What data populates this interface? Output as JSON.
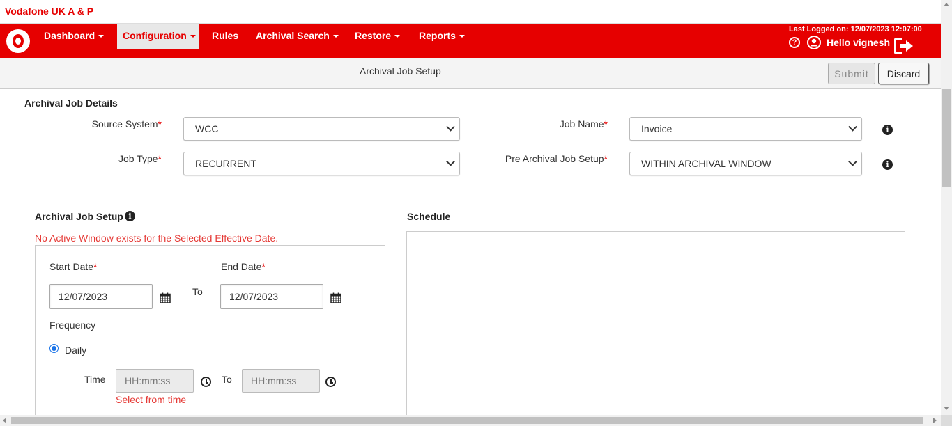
{
  "app": {
    "title": "Vodafone UK A & P"
  },
  "nav": {
    "items": [
      {
        "label": "Dashboard",
        "dropdown": true
      },
      {
        "label": "Configuration",
        "dropdown": true,
        "active": true
      },
      {
        "label": "Rules",
        "dropdown": false
      },
      {
        "label": "Archival Search",
        "dropdown": true
      },
      {
        "label": "Restore",
        "dropdown": true
      },
      {
        "label": "Reports",
        "dropdown": true
      }
    ],
    "last_logged": "Last Logged on: 12/07/2023 12:07:00",
    "greeting": "Hello vignesh",
    "brand_color": "#e60000"
  },
  "subheader": {
    "title": "Archival Job Setup",
    "submit_label": "Submit",
    "discard_label": "Discard"
  },
  "job_details": {
    "heading": "Archival Job Details",
    "source_system": {
      "label": "Source System",
      "value": "WCC"
    },
    "job_name": {
      "label": "Job Name",
      "value": "Invoice"
    },
    "job_type": {
      "label": "Job Type",
      "value": "RECURRENT"
    },
    "pre_archival": {
      "label": "Pre Archival Job Setup",
      "value": "WITHIN ARCHIVAL WINDOW"
    },
    "required_marker": "*"
  },
  "setup": {
    "heading": "Archival Job Setup",
    "error": "No Active Window exists for the Selected Effective Date.",
    "start_date_label": "Start Date",
    "start_date_value": "12/07/2023",
    "to_label": "To",
    "end_date_label": "End Date",
    "end_date_value": "12/07/2023",
    "frequency_label": "Frequency",
    "frequency_option": "Daily",
    "time_label": "Time",
    "time_from_placeholder": "HH:mm:ss",
    "time_to_label": "To",
    "time_to_placeholder": "HH:mm:ss",
    "time_error": "Select from time"
  },
  "schedule": {
    "heading": "Schedule"
  }
}
